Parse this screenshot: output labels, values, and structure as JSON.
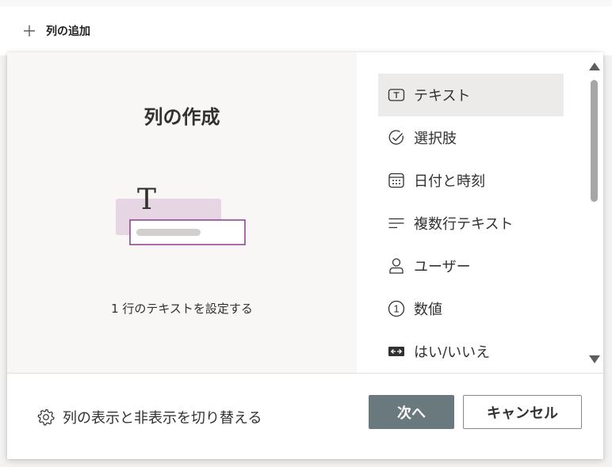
{
  "header": {
    "add_column_icon": "plus-icon",
    "add_column_label": "列の追加"
  },
  "preview": {
    "title": "列の作成",
    "illustration_glyph": "T",
    "description": "1 行のテキストを設定する"
  },
  "column_types": [
    {
      "label": "テキスト",
      "icon": "text-box-icon",
      "selected": true
    },
    {
      "label": "選択肢",
      "icon": "check-circle-icon",
      "selected": false
    },
    {
      "label": "日付と時刻",
      "icon": "calendar-icon",
      "selected": false
    },
    {
      "label": "複数行テキスト",
      "icon": "multiline-text-icon",
      "selected": false
    },
    {
      "label": "ユーザー",
      "icon": "person-icon",
      "selected": false
    },
    {
      "label": "数値",
      "icon": "number-circle-icon",
      "number_glyph": "1",
      "selected": false
    },
    {
      "label": "はい/いいえ",
      "icon": "toggle-yes-no-icon",
      "selected": false
    }
  ],
  "footer": {
    "toggle_icon": "gear-icon",
    "toggle_columns_label": "列の表示と非表示を切り替える",
    "next_label": "次へ",
    "cancel_label": "キャンセル"
  },
  "colors": {
    "accent": "#8a3b8a",
    "illustration_fill": "#e6d5e2",
    "next_button": "#69797e",
    "selected_item": "#ecebea"
  }
}
